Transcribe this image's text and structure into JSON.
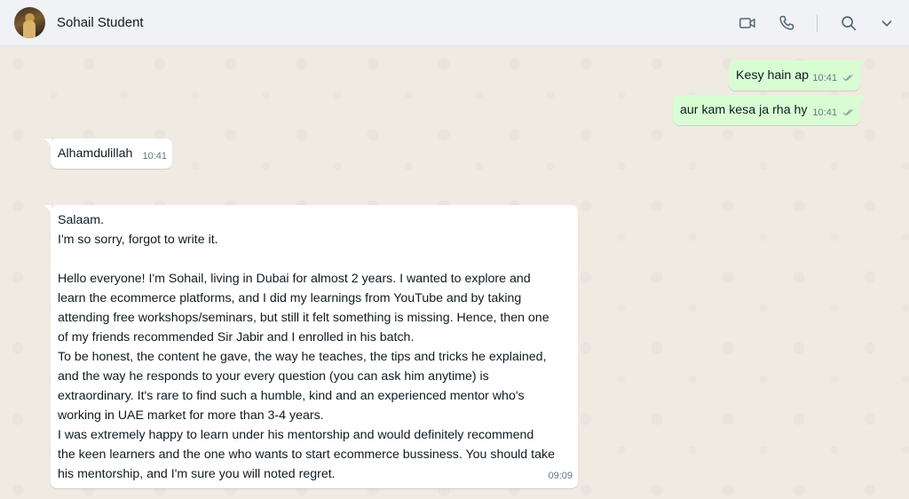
{
  "header": {
    "contact_name": "Sohail Student",
    "icons": [
      "video-call-icon",
      "voice-call-icon",
      "search-icon",
      "chevron-down-icon"
    ]
  },
  "messages": [
    {
      "direction": "outgoing",
      "text": "Kesy hain ap",
      "time": "10:41",
      "status": "read"
    },
    {
      "direction": "outgoing",
      "text": "aur kam kesa ja rha hy",
      "time": "10:41",
      "status": "read"
    },
    {
      "direction": "incoming",
      "text": "Alhamdulillah",
      "time": "10:41"
    },
    {
      "direction": "incoming",
      "lines": [
        "Salaam.",
        "I'm so sorry, forgot to write it.",
        "",
        "Hello everyone! I'm Sohail, living in Dubai for almost 2 years. I wanted to explore and",
        "learn the ecommerce platforms, and I did my learnings from YouTube and by taking",
        "attending free workshops/seminars, but still it felt something is missing. Hence, then one",
        "of my friends recommended Sir Jabir and I enrolled in his batch.",
        "To be honest, the content he gave, the way he teaches, the tips and tricks he explained,",
        "and the way he responds to your every question (you can ask him anytime) is",
        "extraordinary. It's rare to find such a humble, kind and an experienced mentor who's",
        "working in UAE market for more than 3-4 years.",
        "I was extremely happy to learn under his mentorship and would definitely recommend",
        "the keen learners and the one who wants to start ecommerce bussiness. You should take",
        "his mentorship, and I'm sure you will noted regret."
      ],
      "time": "09:09"
    }
  ],
  "colors": {
    "outgoing_bubble": "#d9fdd3",
    "incoming_bubble": "#ffffff",
    "chat_background": "#efeae2",
    "header_background": "#f0f2f5",
    "read_ticks": "#8696a0"
  }
}
